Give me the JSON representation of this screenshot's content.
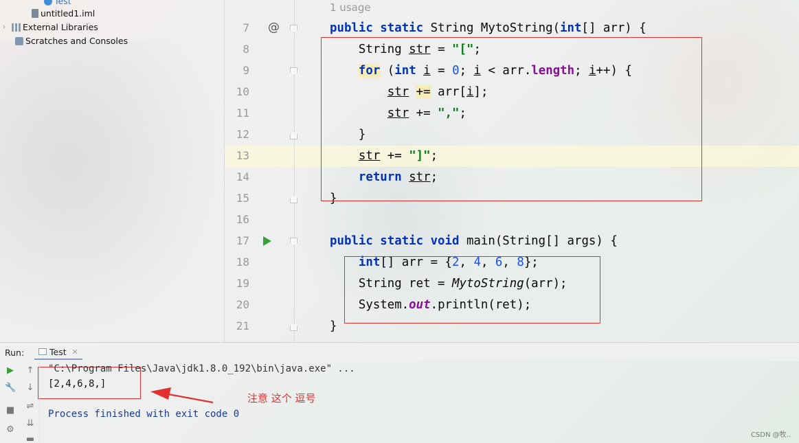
{
  "project_tree": {
    "items": [
      {
        "label": "Test",
        "icon": "class-icon"
      },
      {
        "label": "untitled1.iml",
        "icon": "module-file-icon"
      },
      {
        "label": "External Libraries",
        "icon": "libraries-icon"
      },
      {
        "label": "Scratches and Consoles",
        "icon": "scratches-icon"
      }
    ]
  },
  "editor": {
    "usage_hint": "1 usage",
    "line_numbers": [
      "7",
      "8",
      "9",
      "10",
      "11",
      "12",
      "13",
      "14",
      "15",
      "16",
      "17",
      "18",
      "19",
      "20",
      "21"
    ],
    "gutter_icons": {
      "override": "@",
      "run": "run-icon"
    }
  },
  "run_panel": {
    "label": "Run:",
    "tab_label": "Test",
    "console": {
      "command": "\"C:\\Program Files\\Java\\jdk1.8.0_192\\bin\\java.exe\" ...",
      "output": "[2,4,6,8,]",
      "exit_message": "Process finished with exit code 0"
    }
  },
  "annotation": "注意 这个 逗号",
  "watermark": "CSDN @牧..",
  "colors": {
    "keyword": "#0033b3",
    "string": "#067d17",
    "number": "#1750eb",
    "field": "#871094",
    "annotation_red": "#e03030"
  }
}
